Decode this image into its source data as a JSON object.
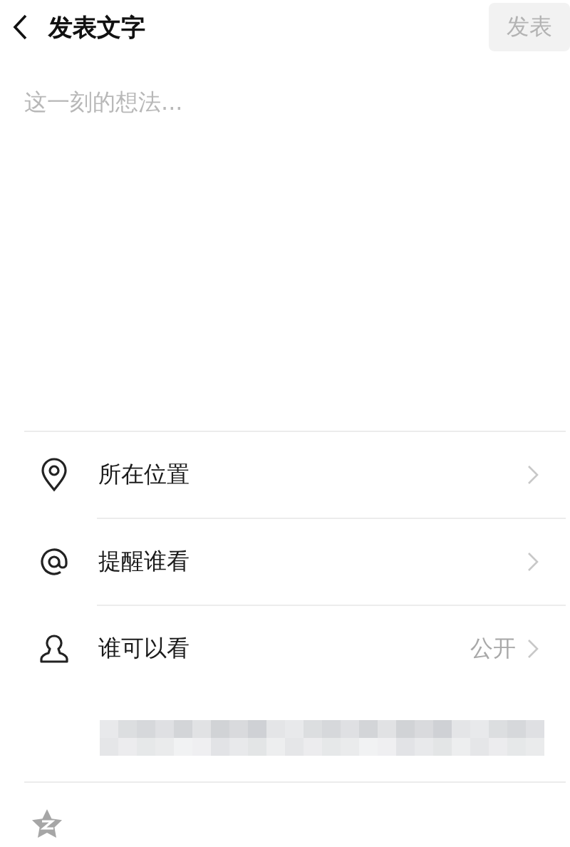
{
  "header": {
    "title": "发表文字",
    "submit": {
      "label": "发表",
      "disabled": true
    }
  },
  "composer": {
    "placeholder": "这一刻的想法..."
  },
  "options": [
    {
      "kind": "location",
      "label": "所在位置"
    },
    {
      "kind": "mention",
      "label": "提醒谁看"
    },
    {
      "kind": "audience",
      "label": "谁可以看",
      "value": "公开"
    }
  ]
}
